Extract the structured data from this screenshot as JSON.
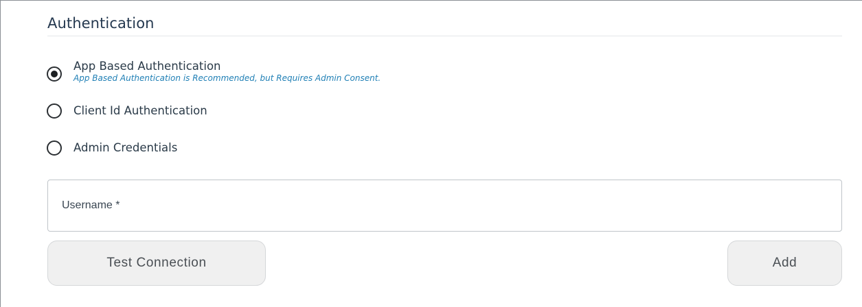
{
  "section": {
    "title": "Authentication"
  },
  "auth_options": [
    {
      "label": "App Based Authentication",
      "hint": "App Based Authentication is Recommended, but Requires Admin Consent.",
      "selected": true
    },
    {
      "label": "Client Id Authentication",
      "selected": false
    },
    {
      "label": "Admin Credentials",
      "selected": false
    }
  ],
  "username": {
    "placeholder": "Username *",
    "value": ""
  },
  "buttons": {
    "test_connection": "Test Connection",
    "add": "Add"
  },
  "colors": {
    "title": "#24384f",
    "hint": "#1f7fb5",
    "button_bg": "#f0f0f0"
  }
}
